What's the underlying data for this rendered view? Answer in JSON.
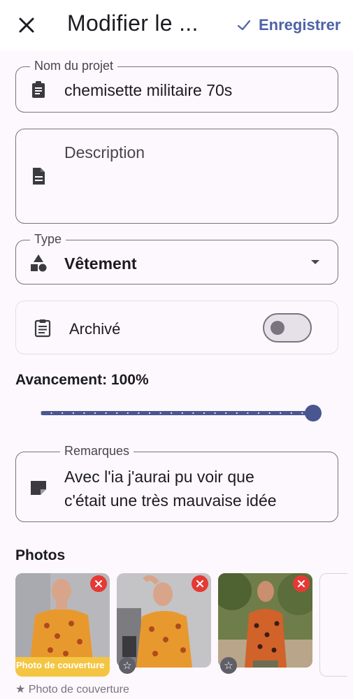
{
  "header": {
    "title": "Modifier le ...",
    "save_label": "Enregistrer",
    "close_icon": "close-icon",
    "save_icon": "check-icon"
  },
  "project_name": {
    "label": "Nom du projet",
    "value": "chemisette militaire 70s",
    "icon": "clipboard-icon"
  },
  "description": {
    "placeholder": "Description",
    "icon": "document-icon"
  },
  "type": {
    "label": "Type",
    "value": "Vêtement",
    "icon": "shapes-icon"
  },
  "archive": {
    "label": "Archivé",
    "enabled": false,
    "icon": "clipboard-list-icon"
  },
  "progress": {
    "label": "Avancement: 100%",
    "value": 100
  },
  "remarks": {
    "label": "Remarques",
    "line1": "Avec l'ia j'aurai pu voir que",
    "line2": "c'était une très mauvaise idée",
    "icon": "note-icon"
  },
  "photos": {
    "heading": "Photos",
    "cover_banner": "Photo de couverture",
    "cover_hint": "★ Photo de couverture",
    "items": [
      {
        "cover": true
      },
      {
        "cover": false
      },
      {
        "cover": false
      }
    ]
  },
  "colors": {
    "accent": "#4d62a8",
    "slider": "#4a5690",
    "delete": "#e53935",
    "cover": "#f4c542"
  }
}
